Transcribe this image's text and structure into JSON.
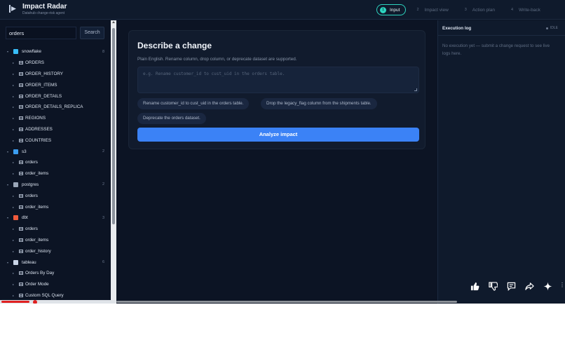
{
  "app": {
    "title": "Impact Radar",
    "subtitle": "Datahub change-risk agent"
  },
  "steps": [
    {
      "num": "1",
      "label": "Input",
      "active": true
    },
    {
      "num": "2",
      "label": "Impact view",
      "active": false
    },
    {
      "num": "3",
      "label": "Action plan",
      "active": false
    },
    {
      "num": "4",
      "label": "Write-back",
      "active": false
    }
  ],
  "search": {
    "value": "orders",
    "button_label": "Search"
  },
  "tree": [
    {
      "kind": "source",
      "name": "snowflake",
      "count": "8",
      "icon": "snowflake-icon",
      "color": "#38bdf8"
    },
    {
      "kind": "table",
      "name": "ORDERS"
    },
    {
      "kind": "table",
      "name": "ORDER_HISTORY"
    },
    {
      "kind": "table",
      "name": "ORDER_ITEMS"
    },
    {
      "kind": "table",
      "name": "ORDER_DETAILS"
    },
    {
      "kind": "table",
      "name": "ORDER_DETAILS_REPLICA"
    },
    {
      "kind": "table",
      "name": "REGIONS"
    },
    {
      "kind": "table",
      "name": "ADDRESSES"
    },
    {
      "kind": "table",
      "name": "COUNTRIES"
    },
    {
      "kind": "source",
      "name": "s3",
      "count": "2",
      "icon": "s3-bucket-icon",
      "color": "#3b9df0"
    },
    {
      "kind": "table",
      "name": "orders"
    },
    {
      "kind": "table",
      "name": "order_items"
    },
    {
      "kind": "source",
      "name": "postgres",
      "count": "2",
      "icon": "postgres-icon",
      "color": "#9aa6b8"
    },
    {
      "kind": "table",
      "name": "orders"
    },
    {
      "kind": "table",
      "name": "order_items"
    },
    {
      "kind": "source",
      "name": "dbt",
      "count": "3",
      "icon": "dbt-icon",
      "color": "#f05a3c"
    },
    {
      "kind": "table",
      "name": "orders"
    },
    {
      "kind": "table",
      "name": "order_items"
    },
    {
      "kind": "table",
      "name": "order_history"
    },
    {
      "kind": "source",
      "name": "tableau",
      "count": "6",
      "icon": "tableau-icon",
      "color": "#c9d4e6"
    },
    {
      "kind": "table",
      "name": "Orders By Day"
    },
    {
      "kind": "table",
      "name": "Order Mode"
    },
    {
      "kind": "table",
      "name": "Custom SQL Query"
    }
  ],
  "main": {
    "title": "Describe a change",
    "help": "Plain English. Rename column, drop column, or deprecate dataset are supported.",
    "placeholder": "e.g. Rename customer_id to cust_uid in the orders table.",
    "examples": [
      "Rename customer_id to cust_uid in the orders table.",
      "Drop the legacy_flag column from the shipments table.",
      "Deprecate the orders dataset."
    ],
    "analyze_label": "Analyze impact"
  },
  "log": {
    "title": "Execution log",
    "status": "IDLE",
    "empty": "No execution yet — submit a change request to see live logs here."
  },
  "colors": {
    "accent_teal": "#2dd4bf",
    "primary_blue": "#3b82f6",
    "background": "#0c1424"
  },
  "fab_icons": [
    "thumbs-up-icon",
    "thumbs-down-icon",
    "comment-icon",
    "share-icon",
    "sparkle-icon"
  ]
}
